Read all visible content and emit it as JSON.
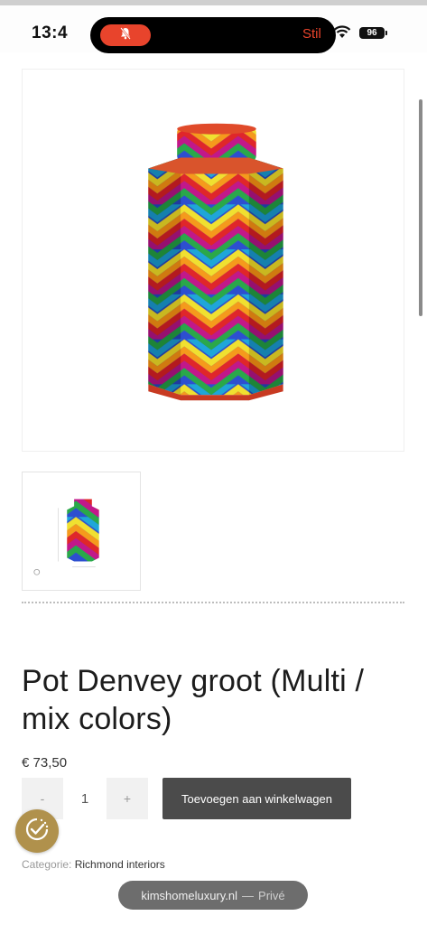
{
  "status_bar": {
    "time": "13:4",
    "mode": "Stil",
    "battery": "96",
    "bell_icon": "bell-slash-icon",
    "wifi_icon": "wifi-icon"
  },
  "product": {
    "title": "Pot Denvey groot (Multi / mix colors)",
    "price": "€ 73,50",
    "quantity": "1",
    "qty_minus_label": "-",
    "qty_plus_label": "+",
    "add_to_cart_label": "Toevoegen aan winkelwagen",
    "category_label": "Categorie:",
    "category_value": "Richmond interiors"
  },
  "browser": {
    "domain": "kimshomeluxury.nl",
    "separator": "—",
    "mode": "Privé"
  },
  "colors": {
    "accent_red": "#e8442c",
    "button_dark": "#4b4b4b",
    "cookie_gold": "#b0914c"
  }
}
